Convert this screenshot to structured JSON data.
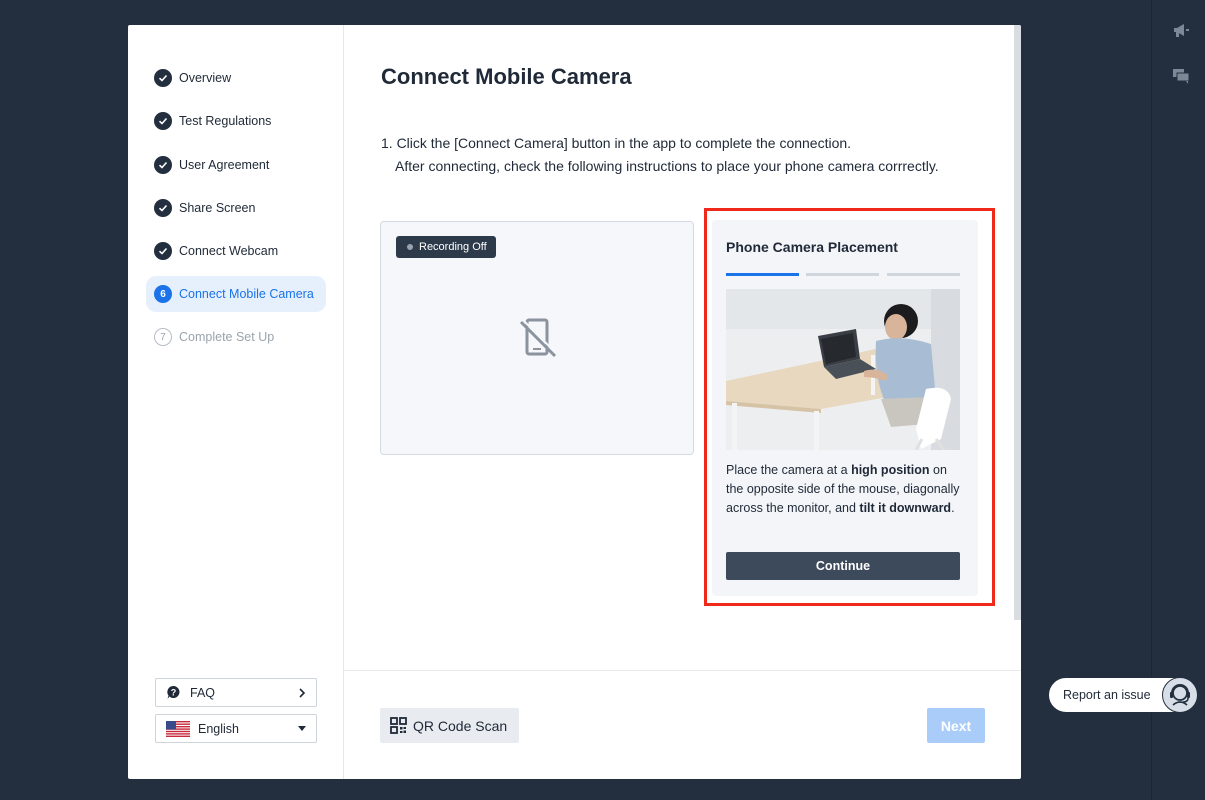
{
  "sidebar": {
    "steps": [
      {
        "label": "Overview",
        "state": "done"
      },
      {
        "label": "Test Regulations",
        "state": "done"
      },
      {
        "label": "User Agreement",
        "state": "done"
      },
      {
        "label": "Share Screen",
        "state": "done"
      },
      {
        "label": "Connect Webcam",
        "state": "done"
      },
      {
        "label": "Connect Mobile Camera",
        "state": "active",
        "number": "6"
      },
      {
        "label": "Complete Set Up",
        "state": "todo",
        "number": "7"
      }
    ],
    "faq_label": "FAQ",
    "language_label": "English"
  },
  "main": {
    "title": "Connect Mobile Camera",
    "instruction_line1": "1. Click the [Connect Camera] button in the app to complete the connection.",
    "instruction_line2": "After connecting, check the following instructions to place your phone camera corrrectly.",
    "recording_status": "Recording Off",
    "card": {
      "title": "Phone Camera Placement",
      "progress_step": 1,
      "progress_total": 3,
      "desc_part1": "Place the camera at a ",
      "desc_bold1": "high position",
      "desc_part2": " on the opposite side of the mouse, diagonally across the monitor, and ",
      "desc_bold2": "tilt it downward",
      "desc_part3": ".",
      "continue_label": "Continue"
    },
    "qr_label": "QR Code Scan",
    "next_label": "Next"
  },
  "report_label": "Report an issue",
  "colors": {
    "background": "#232f3e",
    "accent": "#1a73e8",
    "highlight": "#f02a1b",
    "next_disabled": "#a9cdf8"
  }
}
